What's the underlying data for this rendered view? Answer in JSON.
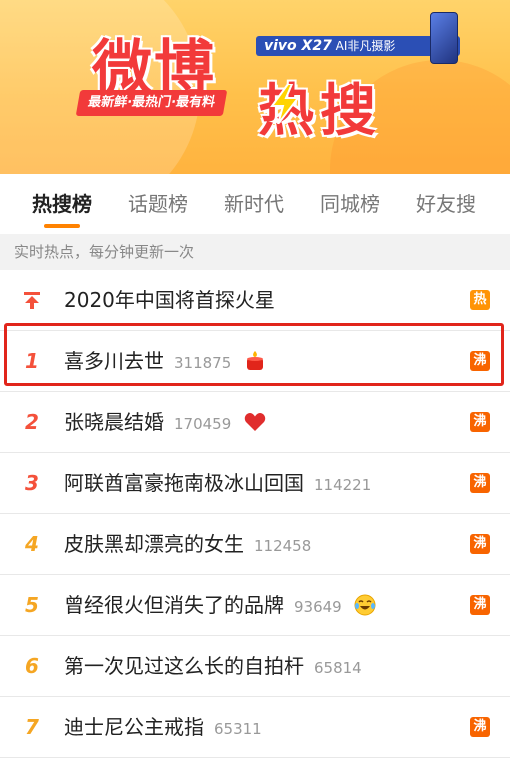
{
  "banner": {
    "brand_main": "微博",
    "brand_hot": "热搜",
    "slogan": "最新鲜·最热门·最有料",
    "ad_model": "vivo X27",
    "ad_tagline": "AI非凡摄影",
    "brand_color": "#f23a3a"
  },
  "tabs": [
    "热搜榜",
    "话题榜",
    "新时代",
    "同城榜",
    "好友搜"
  ],
  "section_header": "实时热点，每分钟更新一次",
  "list": [
    {
      "rank": "",
      "pinned": true,
      "title": "2020年中国将首探火星",
      "count": "",
      "emoji": "",
      "badge": "热",
      "badge_color": "#ff9406"
    },
    {
      "rank": "1",
      "title": "喜多川去世",
      "count": "311875",
      "emoji": "candle-icon",
      "badge": "沸",
      "badge_color": "#f86400"
    },
    {
      "rank": "2",
      "title": "张晓晨结婚",
      "count": "170459",
      "emoji": "heart-icon",
      "badge": "沸",
      "badge_color": "#f86400"
    },
    {
      "rank": "3",
      "title": "阿联酋富豪拖南极冰山回国",
      "count": "114221",
      "emoji": "",
      "badge": "沸",
      "badge_color": "#f86400"
    },
    {
      "rank": "4",
      "title": "皮肤黑却漂亮的女生",
      "count": "112458",
      "emoji": "",
      "badge": "沸",
      "badge_color": "#f86400"
    },
    {
      "rank": "5",
      "title": "曾经很火但消失了的品牌",
      "count": "93649",
      "emoji": "laugh-cry-icon",
      "badge": "沸",
      "badge_color": "#f86400"
    },
    {
      "rank": "6",
      "title": "第一次见过这么长的自拍杆",
      "count": "65814",
      "emoji": "",
      "badge": "",
      "badge_color": ""
    },
    {
      "rank": "7",
      "title": "迪士尼公主戒指",
      "count": "65311",
      "emoji": "",
      "badge": "沸",
      "badge_color": "#f86400"
    }
  ],
  "colors": {
    "rank_top3": "#f4513b",
    "rank_rest": "#f5a623",
    "tab_active_underline": "#ff8200",
    "highlight_border": "#e1251b"
  }
}
